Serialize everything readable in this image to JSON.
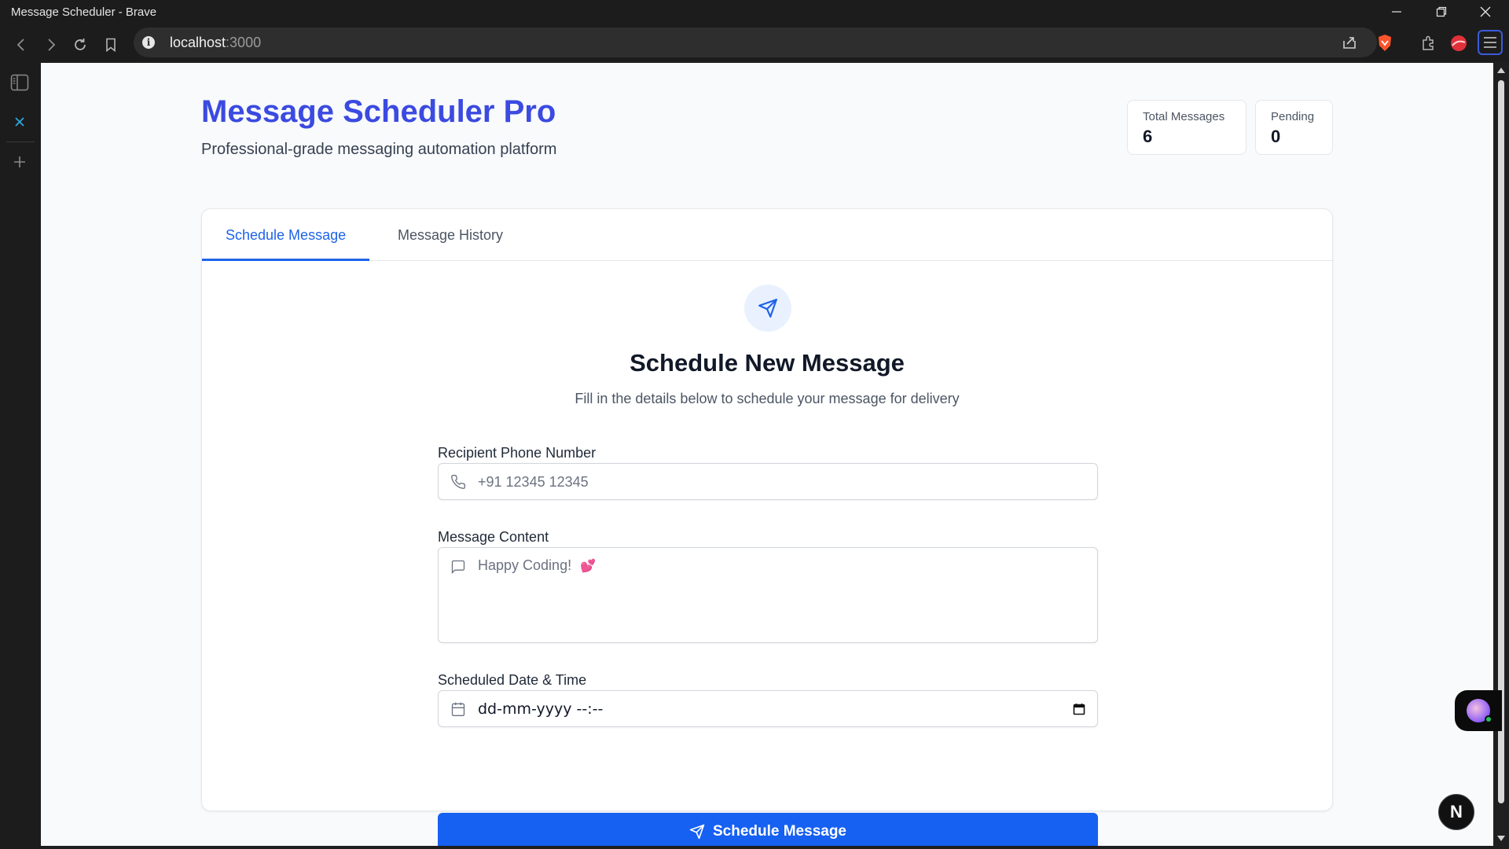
{
  "browser": {
    "window_title": "Message Scheduler - Brave",
    "url_host": "localhost",
    "url_port": ":3000"
  },
  "app": {
    "title": "Message Scheduler Pro",
    "subtitle": "Professional-grade messaging automation platform",
    "accent_color": "#3b4ae0",
    "primary_color": "#1660f2"
  },
  "stats": [
    {
      "label": "Total Messages",
      "value": "6"
    },
    {
      "label": "Pending",
      "value": "0"
    }
  ],
  "tabs": [
    {
      "label": "Schedule Message",
      "active": true
    },
    {
      "label": "Message History",
      "active": false
    }
  ],
  "form": {
    "heading": "Schedule New Message",
    "description": "Fill in the details below to schedule your message for delivery",
    "phone": {
      "label": "Recipient Phone Number",
      "placeholder": "+91 12345 12345",
      "icon": "phone-icon"
    },
    "message": {
      "label": "Message Content",
      "placeholder": "Happy Coding!",
      "emoji": "💕",
      "icon": "message-square-icon"
    },
    "datetime": {
      "label": "Scheduled Date & Time",
      "value": "dd-mm-yyyy --:--",
      "icon": "calendar-icon"
    },
    "submit_label": "Schedule Message"
  },
  "floating": {
    "badge_letter": "N"
  }
}
